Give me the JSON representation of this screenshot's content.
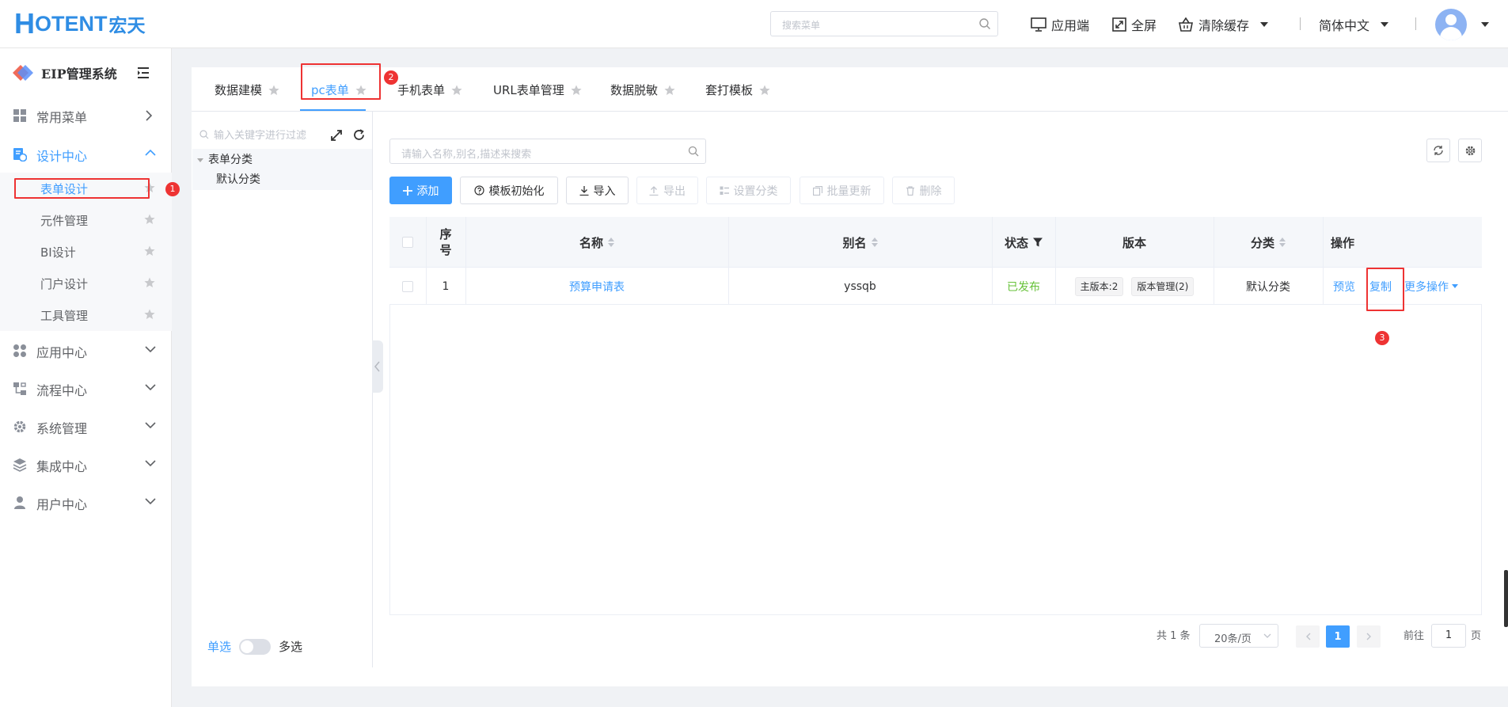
{
  "header": {
    "logo_h": "H",
    "logo_rest": "OTENT",
    "logo_cn": "宏天",
    "search_placeholder": "搜索菜单",
    "app_label": "应用端",
    "fullscreen_label": "全屏",
    "clear_cache_label": "清除缓存",
    "language_label": "简体中文"
  },
  "sidebar": {
    "system_title": "EIP管理系统",
    "menu": [
      {
        "label": "常用菜单",
        "icon": "grid-icon",
        "expanded": false
      },
      {
        "label": "设计中心",
        "icon": "design-icon",
        "expanded": true
      },
      {
        "label": "应用中心",
        "icon": "apps-icon",
        "expanded": false
      },
      {
        "label": "流程中心",
        "icon": "flow-icon",
        "expanded": false
      },
      {
        "label": "系统管理",
        "icon": "gear-icon",
        "expanded": false
      },
      {
        "label": "集成中心",
        "icon": "layers-icon",
        "expanded": false
      },
      {
        "label": "用户中心",
        "icon": "user-icon",
        "expanded": false
      }
    ],
    "design_sub": [
      {
        "label": "表单设计",
        "active": true
      },
      {
        "label": "元件管理",
        "active": false
      },
      {
        "label": "BI设计",
        "active": false
      },
      {
        "label": "门户设计",
        "active": false
      },
      {
        "label": "工具管理",
        "active": false
      }
    ]
  },
  "tabs": [
    {
      "label": "数据建模",
      "active": false
    },
    {
      "label": "pc表单",
      "active": true
    },
    {
      "label": "手机表单",
      "active": false
    },
    {
      "label": "URL表单管理",
      "active": false
    },
    {
      "label": "数据脱敏",
      "active": false
    },
    {
      "label": "套打模板",
      "active": false
    }
  ],
  "tree": {
    "search_placeholder": "输入关键字进行过滤",
    "root": "表单分类",
    "child": "默认分类",
    "single_label": "单选",
    "multi_label": "多选"
  },
  "list": {
    "search_placeholder": "请输入名称,别名,描述来搜索",
    "buttons": {
      "add": "添加",
      "template_init": "模板初始化",
      "import": "导入",
      "export": "导出",
      "set_category": "设置分类",
      "batch_update": "批量更新",
      "delete": "删除"
    },
    "columns": {
      "index": "序号",
      "name": "名称",
      "alias": "别名",
      "status": "状态",
      "version": "版本",
      "category": "分类",
      "actions": "操作"
    },
    "rows": [
      {
        "index": "1",
        "name": "预算申请表",
        "alias": "yssqb",
        "status": "已发布",
        "main_version": "主版本:2",
        "version_mgmt": "版本管理(2)",
        "category": "默认分类",
        "preview": "预览",
        "copy": "复制",
        "more": "更多操作"
      }
    ]
  },
  "pagination": {
    "total": "共 1 条",
    "page_size": "20条/页",
    "current_page": "1",
    "goto_label": "前往",
    "goto_value": "1",
    "page_unit": "页"
  },
  "annotations": {
    "badge_1": "1",
    "badge_2": "2",
    "badge_3": "3"
  },
  "colors": {
    "brand": "#2f8de4",
    "primary": "#409eff",
    "success": "#67c23a",
    "annotation": "#e33333"
  }
}
